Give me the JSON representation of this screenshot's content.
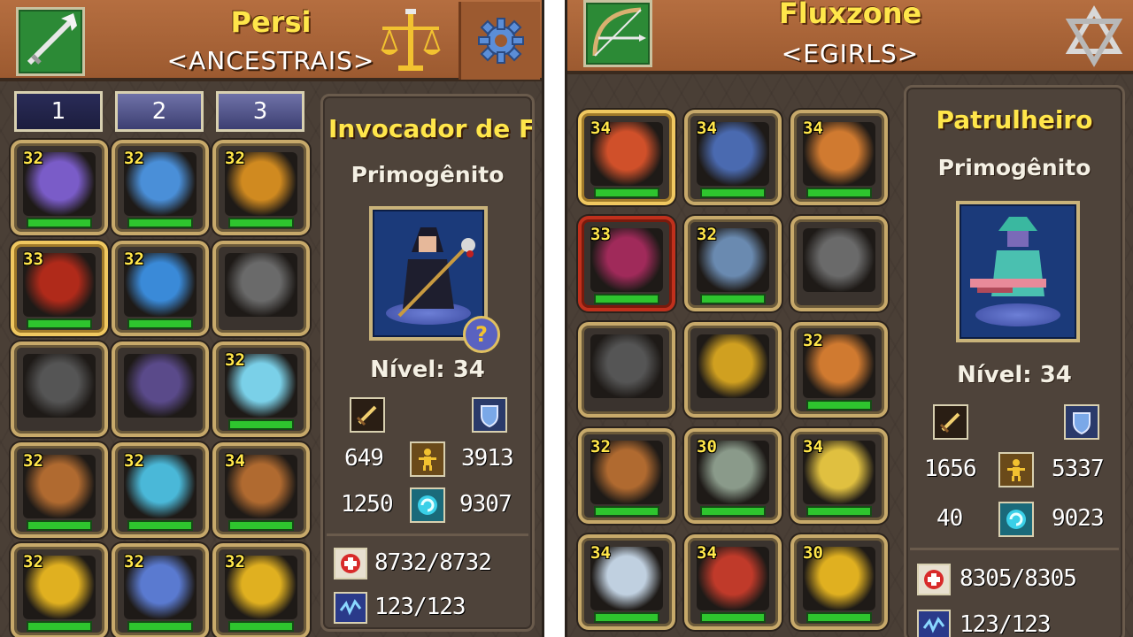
{
  "left": {
    "name": "Persi",
    "guild": "<ANCESTRAIS>",
    "tabs": [
      "1",
      "2",
      "3"
    ],
    "class_name": "Invocador de Fe",
    "subtitle": "Primogênito",
    "level": "Nível: 34",
    "attack": "649",
    "defense": "3913",
    "stat3": "1250",
    "stat4": "9307",
    "hp": "8732/8732",
    "mp": "123/123",
    "slots": [
      {
        "level": "32",
        "icon": "cape-icon",
        "color": "#7a5cc8"
      },
      {
        "level": "32",
        "icon": "helmet-icon",
        "color": "#4a8fd8"
      },
      {
        "level": "32",
        "icon": "amulet-icon",
        "color": "#d08a20"
      },
      {
        "level": "33",
        "icon": "weapon-icon",
        "color": "#b02a1a"
      },
      {
        "level": "32",
        "icon": "armor-icon",
        "color": "#3a8ad8"
      },
      {
        "level": "",
        "icon": "sword-icon",
        "color": "#6a6a6a"
      },
      {
        "level": "",
        "icon": "bird-icon",
        "color": "#555555"
      },
      {
        "level": "",
        "icon": "robe-icon",
        "color": "#5a4a8a"
      },
      {
        "level": "32",
        "icon": "glove-icon",
        "color": "#7ad0e8"
      },
      {
        "level": "32",
        "icon": "ring-icon",
        "color": "#b06a30"
      },
      {
        "level": "32",
        "icon": "bracelet-icon",
        "color": "#4ab8d8"
      },
      {
        "level": "34",
        "icon": "ring-icon",
        "color": "#b06a30"
      },
      {
        "level": "32",
        "icon": "gold-ring-icon",
        "color": "#e0b020"
      },
      {
        "level": "32",
        "icon": "boots-icon",
        "color": "#5a7ad0"
      },
      {
        "level": "32",
        "icon": "gold-ring-icon",
        "color": "#e0b020"
      }
    ]
  },
  "right": {
    "name": "Fluxzone",
    "guild": "<EGIRLS>",
    "class_name": "Patrulheiro",
    "subtitle": "Primogênito",
    "level": "Nível: 34",
    "attack": "1656",
    "defense": "5337",
    "stat3": "40",
    "stat4": "9023",
    "hp": "8305/8305",
    "mp": "123/123",
    "slots": [
      {
        "level": "34",
        "icon": "cape-icon",
        "color": "#d0502a"
      },
      {
        "level": "34",
        "icon": "helmet-icon",
        "color": "#4a6ab0"
      },
      {
        "level": "34",
        "icon": "amulet-icon",
        "color": "#d07a30"
      },
      {
        "level": "33",
        "icon": "weapon-icon",
        "color": "#a02a5a"
      },
      {
        "level": "32",
        "icon": "armor-icon",
        "color": "#6a8ab0"
      },
      {
        "level": "",
        "icon": "sword-icon",
        "color": "#6a6a6a"
      },
      {
        "level": "",
        "icon": "bird-icon",
        "color": "#555555"
      },
      {
        "level": "",
        "icon": "jester-icon",
        "color": "#d0a020"
      },
      {
        "level": "32",
        "icon": "glove-icon",
        "color": "#d07a30"
      },
      {
        "level": "32",
        "icon": "ring-icon",
        "color": "#b06a30"
      },
      {
        "level": "30",
        "icon": "bracelet-icon",
        "color": "#8a9a8a"
      },
      {
        "level": "34",
        "icon": "orb-ring-icon",
        "color": "#e0c040"
      },
      {
        "level": "34",
        "icon": "ring-icon",
        "color": "#c0d0e0"
      },
      {
        "level": "34",
        "icon": "boots-icon",
        "color": "#c03a2a"
      },
      {
        "level": "30",
        "icon": "gold-ring-icon",
        "color": "#e0b020"
      }
    ]
  }
}
